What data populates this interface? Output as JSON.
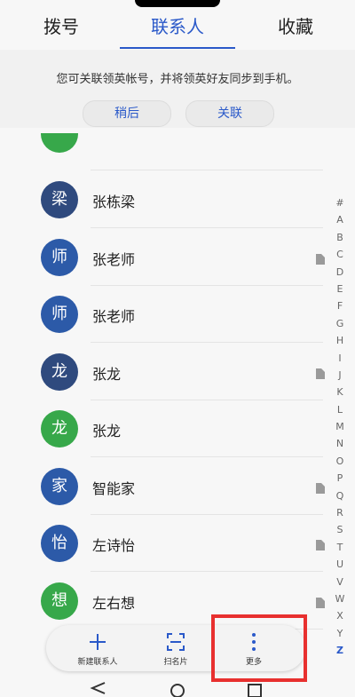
{
  "tabs": [
    {
      "label": "拨号",
      "active": false
    },
    {
      "label": "联系人",
      "active": true
    },
    {
      "label": "收藏",
      "active": false
    }
  ],
  "banner": {
    "text": "您可关联领英帐号，并将领英好友同步到手机。",
    "later_label": "稍后",
    "link_label": "关联"
  },
  "contacts": [
    {
      "name": "张栋梁",
      "avatar_char": "梁",
      "avatar_color": "#2f4a7e",
      "has_card": false
    },
    {
      "name": "张老师",
      "avatar_char": "师",
      "avatar_color": "#2c5aa8",
      "has_card": true
    },
    {
      "name": "张老师",
      "avatar_char": "师",
      "avatar_color": "#2c5aa8",
      "has_card": false
    },
    {
      "name": "张龙",
      "avatar_char": "龙",
      "avatar_color": "#2f4a7e",
      "has_card": true
    },
    {
      "name": "张龙",
      "avatar_char": "龙",
      "avatar_color": "#37a84a",
      "has_card": false
    },
    {
      "name": "智能家",
      "avatar_char": "家",
      "avatar_color": "#2c5aa8",
      "has_card": true
    },
    {
      "name": "左诗怡",
      "avatar_char": "怡",
      "avatar_color": "#2c5aa8",
      "has_card": true
    },
    {
      "name": "左右想",
      "avatar_char": "想",
      "avatar_color": "#37a84a",
      "has_card": true
    }
  ],
  "partial_avatar_color": "#37a84a",
  "alpha_index": [
    "#",
    "A",
    "B",
    "C",
    "D",
    "E",
    "F",
    "G",
    "H",
    "I",
    "J",
    "K",
    "L",
    "M",
    "N",
    "O",
    "P",
    "Q",
    "R",
    "S",
    "T",
    "U",
    "V",
    "W",
    "X",
    "Y",
    "Z"
  ],
  "alpha_current": "Z",
  "bottom_bar": {
    "new_contact": "新建联系人",
    "scan_card": "扫名片",
    "more": "更多"
  },
  "colors": {
    "accent": "#2a59c9",
    "highlight": "#e8302f"
  }
}
